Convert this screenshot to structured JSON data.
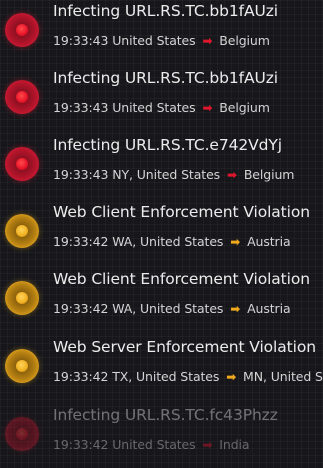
{
  "colors": {
    "critical": "#e0162d",
    "warning": "#f0a81c",
    "background": "#17171b"
  },
  "events": [
    {
      "title": "Infecting URL.RS.TC.bb1fAUzi",
      "time": "19:33:43",
      "source": "United States",
      "destination": "Belgium",
      "severity": "critical",
      "icon": "critical-dot-icon"
    },
    {
      "title": "Infecting URL.RS.TC.bb1fAUzi",
      "time": "19:33:43",
      "source": "United States",
      "destination": "Belgium",
      "severity": "critical",
      "icon": "critical-dot-icon"
    },
    {
      "title": "Infecting URL.RS.TC.e742VdYj",
      "time": "19:33:43",
      "source": "NY, United States",
      "destination": "Belgium",
      "severity": "critical",
      "icon": "critical-dot-icon"
    },
    {
      "title": "Web Client Enforcement Violation",
      "time": "19:33:42",
      "source": "WA, United States",
      "destination": "Austria",
      "severity": "warning",
      "icon": "warning-dot-icon"
    },
    {
      "title": "Web Client Enforcement Violation",
      "time": "19:33:42",
      "source": "WA, United States",
      "destination": "Austria",
      "severity": "warning",
      "icon": "warning-dot-icon"
    },
    {
      "title": "Web Server Enforcement Violation",
      "time": "19:33:42",
      "source": "TX, United States",
      "destination": "MN, United S...",
      "severity": "warning",
      "icon": "warning-dot-icon"
    },
    {
      "title": "Infecting URL.RS.TC.fc43Phzz",
      "time": "19:33:42",
      "source": "United States",
      "destination": "India",
      "severity": "critical",
      "icon": "critical-dot-icon"
    }
  ]
}
